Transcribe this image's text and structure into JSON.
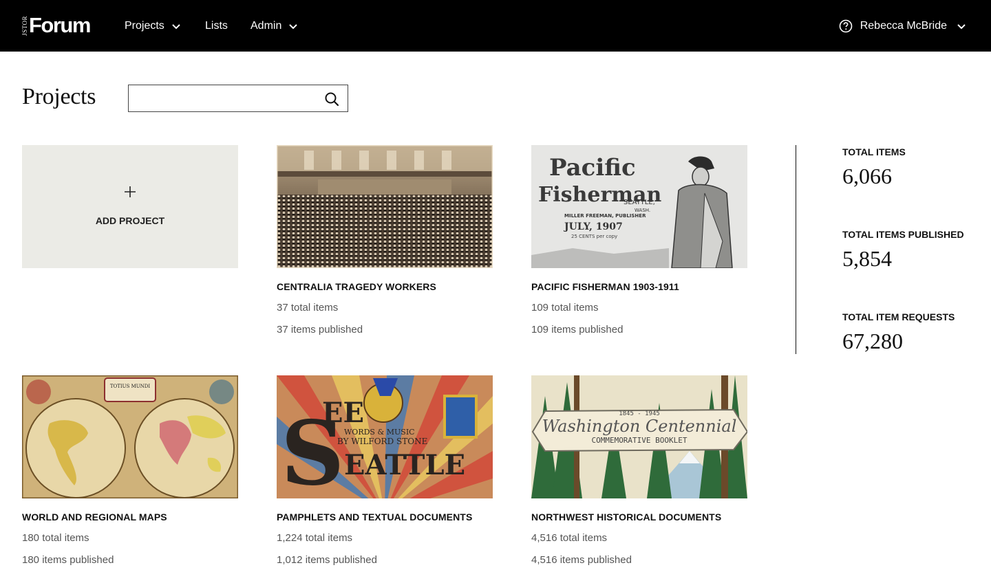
{
  "header": {
    "logo_small": "JSTOR",
    "logo_text": "Forum",
    "nav": [
      {
        "label": "Projects",
        "has_dropdown": true
      },
      {
        "label": "Lists",
        "has_dropdown": false
      },
      {
        "label": "Admin",
        "has_dropdown": true
      }
    ],
    "user_name": "Rebecca McBride",
    "help_icon": "question-circle-icon",
    "user_menu_icon": "chevron-down-icon"
  },
  "page": {
    "title": "Projects",
    "search": {
      "value": "",
      "placeholder": ""
    }
  },
  "add_project": {
    "label": "ADD PROJECT",
    "icon": "plus-icon"
  },
  "projects": [
    {
      "title": "CENTRALIA TRAGEDY WORKERS",
      "total": "37 total items",
      "published": "37 items published"
    },
    {
      "title": "PACIFIC FISHERMAN 1903-1911",
      "total": "109 total items",
      "published": "109 items published",
      "thumb_text": {
        "line1": "Pacific",
        "line2": "Fisherman",
        "city": "SEATTLE,",
        "state": "WASH.",
        "publisher": "MILLER FREEMAN, PUBLISHER",
        "date": "JULY, 1907",
        "price": "25 CENTS per copy"
      }
    },
    {
      "title": "WORLD AND REGIONAL MAPS",
      "total": "180 total items",
      "published": "180 items published",
      "thumb_text": {
        "cartouche": "TOTIUS MUNDI"
      }
    },
    {
      "title": "PAMPHLETS AND TEXTUAL DOCUMENTS",
      "total": "1,224 total items",
      "published": "1,012 items published",
      "thumb_text": {
        "big_s": "S",
        "see": "EE",
        "words": "WORDS & MUSIC",
        "by": "BY WILFORD STONE",
        "eattle": "EATTLE"
      }
    },
    {
      "title": "NORTHWEST HISTORICAL DOCUMENTS",
      "total": "4,516 total items",
      "published": "4,516 items published",
      "thumb_text": {
        "years": "1845 - 1945",
        "script": "Washington Centennial",
        "sub": "COMMEMORATIVE BOOKLET"
      }
    }
  ],
  "stats": [
    {
      "label": "TOTAL ITEMS",
      "value": "6,066"
    },
    {
      "label": "TOTAL ITEMS PUBLISHED",
      "value": "5,854"
    },
    {
      "label": "TOTAL ITEM REQUESTS",
      "value": "67,280"
    }
  ],
  "colors": {
    "topbar": "#000000",
    "add_card_bg": "#ebebe6",
    "meta_text": "#555555"
  }
}
